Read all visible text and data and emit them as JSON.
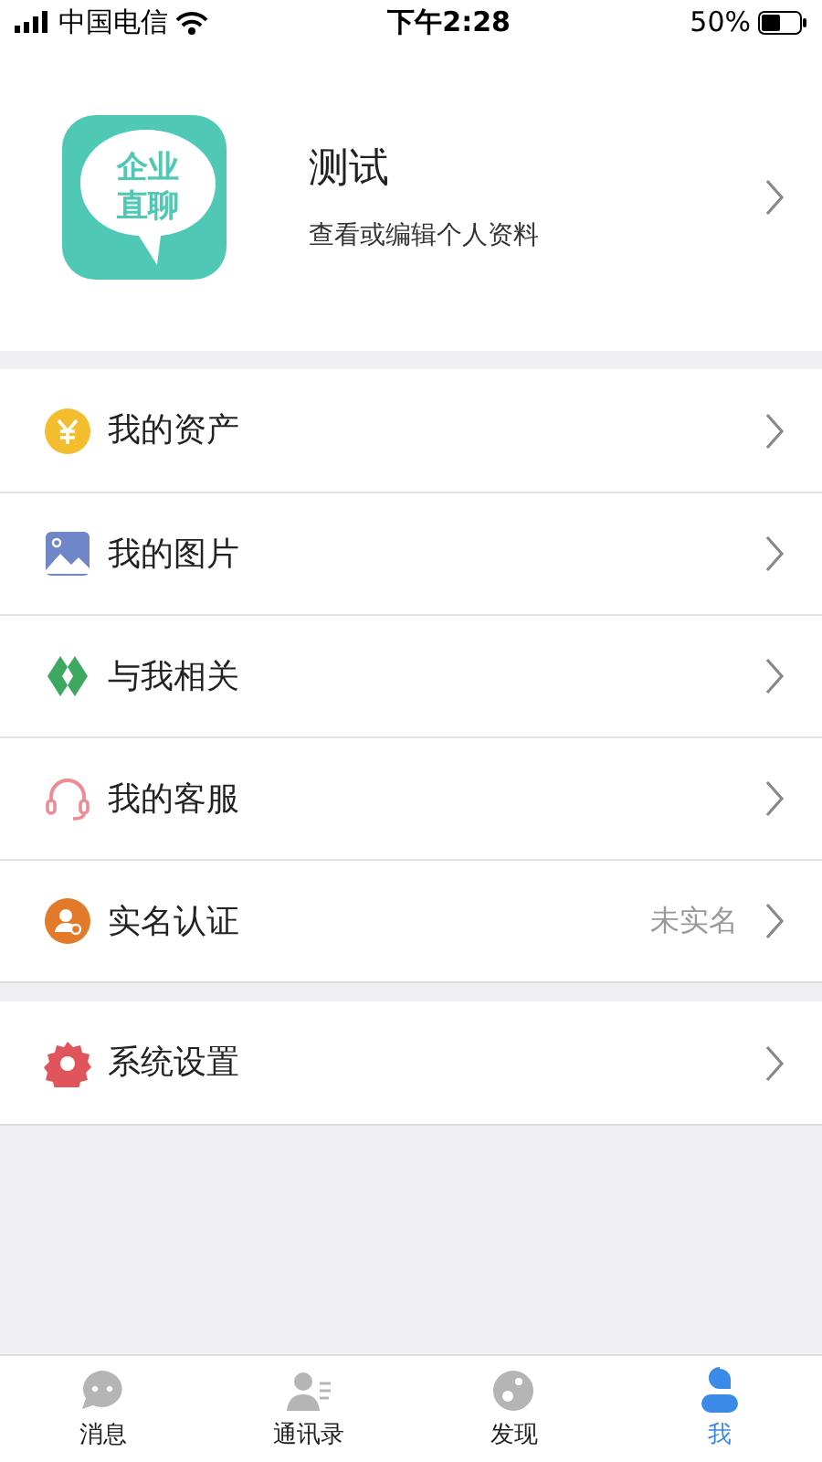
{
  "status_bar": {
    "carrier": "中国电信",
    "time": "下午2:28",
    "battery": "50%"
  },
  "profile": {
    "logo_lines": [
      "企业",
      "直聊"
    ],
    "name": "测试",
    "subtitle": "查看或编辑个人资料"
  },
  "menu_groups": [
    [
      {
        "kind": "assets",
        "label": "我的资产"
      },
      {
        "kind": "pictures",
        "label": "我的图片"
      },
      {
        "kind": "related",
        "label": "与我相关"
      },
      {
        "kind": "service",
        "label": "我的客服"
      },
      {
        "kind": "verify",
        "label": "实名认证",
        "value": "未实名"
      }
    ],
    [
      {
        "kind": "settings",
        "label": "系统设置"
      }
    ]
  ],
  "tabs": [
    {
      "kind": "messages",
      "label": "消息",
      "selected": false
    },
    {
      "kind": "contacts",
      "label": "通讯录",
      "selected": false
    },
    {
      "kind": "discover",
      "label": "发现",
      "selected": false
    },
    {
      "kind": "me",
      "label": "我",
      "selected": true
    }
  ]
}
